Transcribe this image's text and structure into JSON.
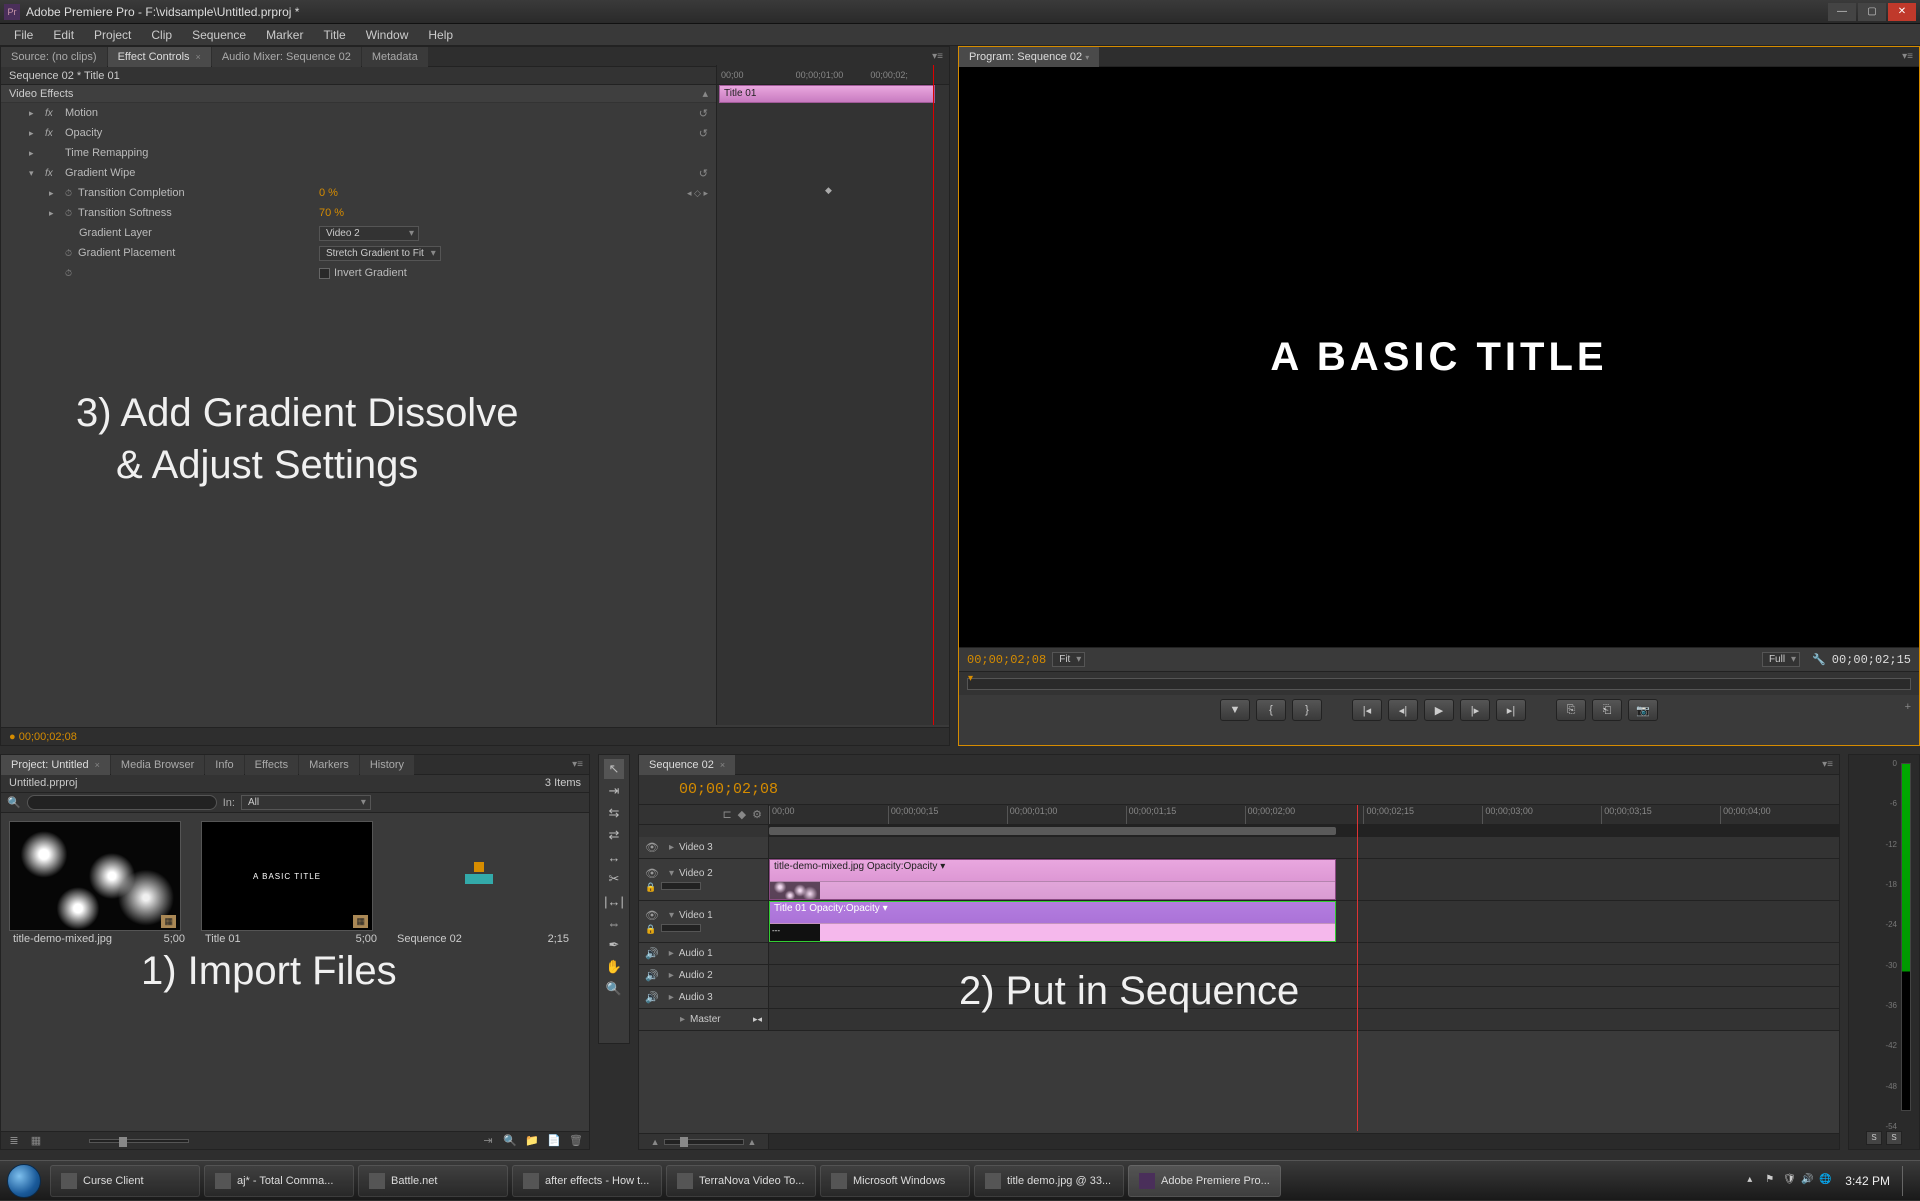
{
  "titlebar": {
    "app": "Pr",
    "text": "Adobe Premiere Pro - F:\\vidsample\\Untitled.prproj *"
  },
  "menus": [
    "File",
    "Edit",
    "Project",
    "Clip",
    "Sequence",
    "Marker",
    "Title",
    "Window",
    "Help"
  ],
  "source_tabs": {
    "source": "Source: (no clips)",
    "effect_controls": "Effect Controls",
    "audio_mixer": "Audio Mixer: Sequence 02",
    "metadata": "Metadata"
  },
  "ec": {
    "header": "Sequence 02 * Title 01",
    "video_effects": "Video Effects",
    "motion": "Motion",
    "opacity": "Opacity",
    "time_remap": "Time Remapping",
    "gradient_wipe": "Gradient Wipe",
    "trans_completion_label": "Transition Completion",
    "trans_completion_val": "0 %",
    "trans_softness_label": "Transition Softness",
    "trans_softness_val": "70 %",
    "gradient_layer_label": "Gradient Layer",
    "gradient_layer_val": "Video 2",
    "gradient_placement_label": "Gradient Placement",
    "gradient_placement_val": "Stretch Gradient to Fit",
    "invert_label": "Invert Gradient",
    "ruler": [
      "00;00",
      "00;00;01;00",
      "00;00;02;"
    ],
    "clip_label": "Title 01",
    "current_tc": "00;00;02;08"
  },
  "program": {
    "tab": "Program: Sequence 02",
    "title_text": "A BASIC TITLE",
    "tc_left": "00;00;02;08",
    "fit": "Fit",
    "full": "Full",
    "tc_right": "00;00;02;15"
  },
  "project": {
    "tab_project": "Project: Untitled",
    "tab_media": "Media Browser",
    "tab_info": "Info",
    "tab_effects": "Effects",
    "tab_markers": "Markers",
    "tab_history": "History",
    "filename": "Untitled.prproj",
    "item_count": "3 Items",
    "in_label": "In:",
    "in_val": "All",
    "items": [
      {
        "name": "title-demo-mixed.jpg",
        "dur": "5;00"
      },
      {
        "name": "Title 01",
        "dur": "5;00"
      },
      {
        "name": "Sequence 02",
        "dur": "2;15"
      }
    ]
  },
  "timeline": {
    "tab": "Sequence 02",
    "tc": "00;00;02;08",
    "ruler": [
      "00;00",
      "00;00;00;15",
      "00;00;01;00",
      "00;00;01;15",
      "00;00;02;00",
      "00;00;02;15",
      "00;00;03;00",
      "00;00;03;15",
      "00;00;04;00"
    ],
    "tracks": {
      "v3": "Video 3",
      "v2": "Video 2",
      "v1": "Video 1",
      "a1": "Audio 1",
      "a2": "Audio 2",
      "a3": "Audio 3",
      "master": "Master"
    },
    "clip_v2": "title-demo-mixed.jpg",
    "clip_v2_fx": "Opacity:Opacity ▾",
    "clip_v1": "Title 01",
    "clip_v1_fx": "Opacity:Opacity ▾"
  },
  "meters": {
    "scale": [
      "0",
      "-6",
      "-12",
      "-18",
      "-24",
      "-30",
      "-36",
      "-42",
      "-48",
      "-54"
    ],
    "solo": "S"
  },
  "annotations": {
    "a1": "1) Import Files",
    "a2": "2) Put in Sequence",
    "a3_l1": "3) Add Gradient Dissolve",
    "a3_l2": "& Adjust Settings"
  },
  "taskbar": {
    "items": [
      "Curse Client",
      "aj* - Total Comma...",
      "Battle.net",
      "after effects - How t...",
      "TerraNova Video To...",
      "Microsoft Windows",
      "title demo.jpg @ 33...",
      "Adobe Premiere Pro..."
    ],
    "clock": "3:42 PM"
  }
}
